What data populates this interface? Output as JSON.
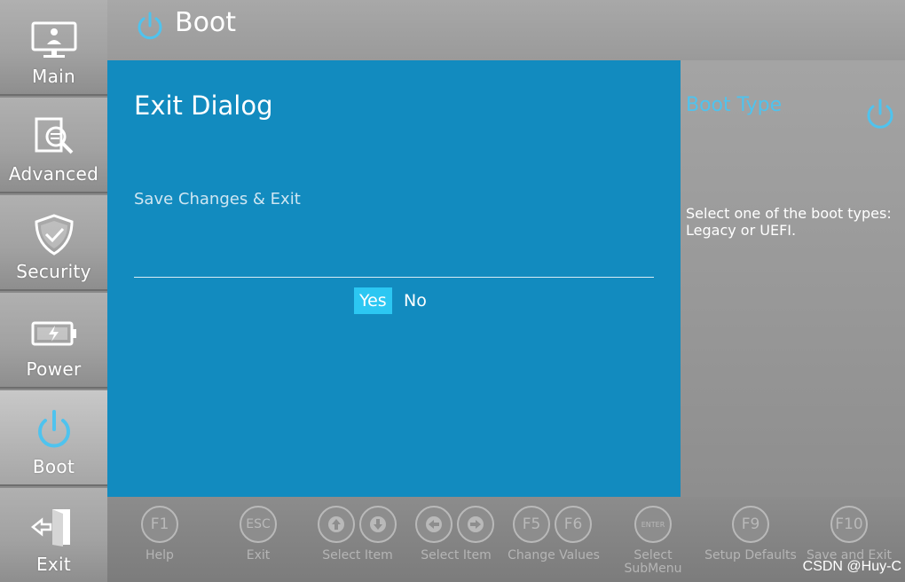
{
  "header": {
    "title": "Boot",
    "icon": "power-icon"
  },
  "sidebar": {
    "items": [
      {
        "label": "Main",
        "icon": "monitor-icon"
      },
      {
        "label": "Advanced",
        "icon": "document-search-icon"
      },
      {
        "label": "Security",
        "icon": "shield-check-icon"
      },
      {
        "label": "Power",
        "icon": "battery-icon"
      },
      {
        "label": "Boot",
        "icon": "power-icon"
      },
      {
        "label": "Exit",
        "icon": "exit-door-icon"
      }
    ],
    "active": "Boot"
  },
  "dialog": {
    "title": "Exit Dialog",
    "message": "Save Changes & Exit",
    "options": {
      "yes": "Yes",
      "no": "No"
    },
    "selected": "Yes"
  },
  "help": {
    "title": "Boot Type",
    "description": "Select one of the boot types: Legacy or UEFI."
  },
  "footer": {
    "keys": {
      "f1": "F1",
      "esc": "ESC",
      "enter": "ENTER",
      "f5": "F5",
      "f6": "F6",
      "f9": "F9",
      "f10": "F10"
    },
    "labels": {
      "help": "Help",
      "exit": "Exit",
      "select_item_vertical": "Select Item",
      "select_item_horizontal": "Select Item",
      "change_values": "Change Values",
      "select_submenu_line1": "Select",
      "select_submenu_line2": "SubMenu",
      "setup_defaults": "Setup Defaults",
      "save_and_exit": "Save and Exit"
    }
  },
  "watermark": "CSDN @Huy-C",
  "colors": {
    "dialog_bg": "#128bbf",
    "selected_bg": "#2cc7f2",
    "accent": "#4fc3ee"
  }
}
